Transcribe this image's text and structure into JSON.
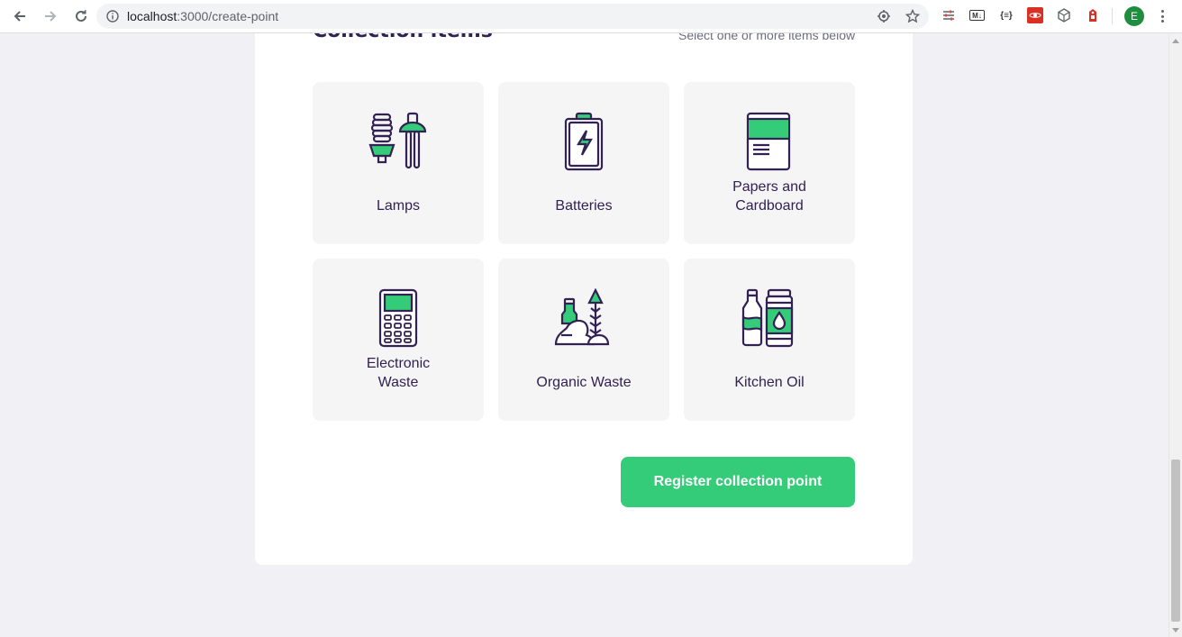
{
  "browser": {
    "url_host": "localhost",
    "url_path": ":3000/create-point",
    "profile_initial": "E",
    "ext_md": "M↓",
    "ext_json": "{≡}"
  },
  "form": {
    "section_title": "Collection items",
    "section_hint": "Select one or more items below",
    "items": [
      {
        "label": "Lamps",
        "icon": "lamps-icon"
      },
      {
        "label": "Batteries",
        "icon": "battery-icon"
      },
      {
        "label": "Papers and Cardboard",
        "icon": "paper-icon"
      },
      {
        "label": "Electronic Waste",
        "icon": "electronic-icon"
      },
      {
        "label": "Organic Waste",
        "icon": "organic-icon"
      },
      {
        "label": "Kitchen Oil",
        "icon": "oil-icon"
      }
    ],
    "submit_label": "Register collection point"
  },
  "colors": {
    "primary": "#34CB79",
    "title": "#322153",
    "text": "#6C6C80",
    "background": "#F0F0F5"
  }
}
